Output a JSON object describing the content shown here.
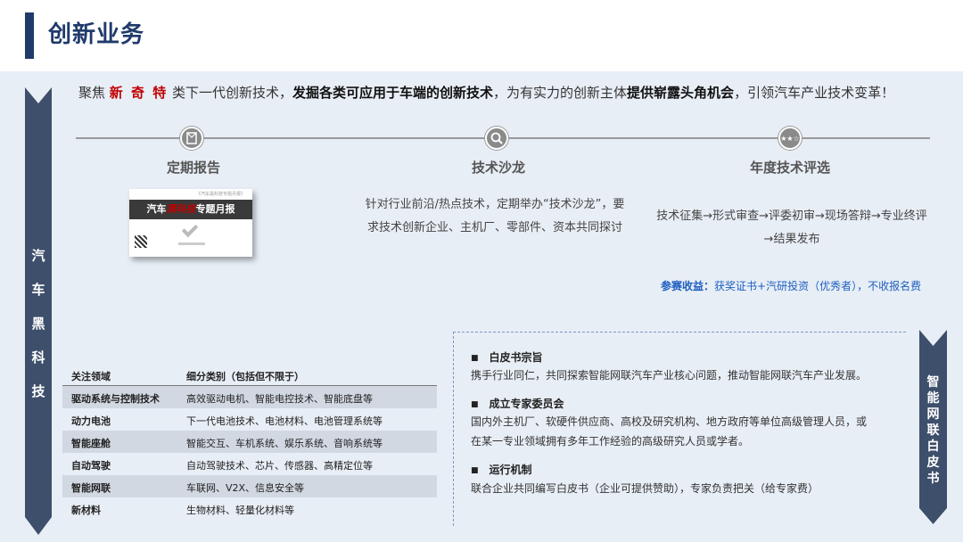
{
  "header": {
    "title": "创新业务"
  },
  "ribbons": {
    "left_label": "汽车黑科技",
    "right_label": "智能网联白皮书"
  },
  "intro": {
    "part1": "聚焦 ",
    "red": "新 奇 特",
    "part2": " 类下一代创新技术，",
    "bold1": "发掘各类可应用于车端的创新技术",
    "part3": "，为有实力的创新主体",
    "bold2": "提供崭露头角机会",
    "part4": "，引领汽车产业技术变革！"
  },
  "columns": [
    {
      "title": "定期报告",
      "icon": "report-icon"
    },
    {
      "title": "技术沙龙",
      "icon": "search-icon",
      "desc": "针对行业前沿/热点技术，定期举办“技术沙龙”，要求技术创新企业、主机厂、零部件、资本共同探讨"
    },
    {
      "title": "年度技术评选",
      "icon": "stars-icon",
      "desc": "技术征集→形式审查→评委初审→现场答辩→专业终评→结果发布"
    }
  ],
  "report_cover": {
    "top_text": "《汽车黑科技专题月报》",
    "band_prefix": "汽车",
    "band_red": "黑科技",
    "band_suffix": "专题月报"
  },
  "benefit": {
    "label": "参赛收益：",
    "text": "获奖证书+汽研投资（优秀者），不收报名费"
  },
  "table": {
    "headers": [
      "关注领域",
      "细分类别（包括但不限于）"
    ],
    "rows": [
      [
        "驱动系统与控制技术",
        "高效驱动电机、智能电控技术、智能底盘等"
      ],
      [
        "动力电池",
        "下一代电池技术、电池材料、电池管理系统等"
      ],
      [
        "智能座舱",
        "智能交互、车机系统、娱乐系统、音响系统等"
      ],
      [
        "自动驾驶",
        "自动驾驶技术、芯片、传感器、高精定位等"
      ],
      [
        "智能网联",
        "车联网、V2X、信息安全等"
      ],
      [
        "新材料",
        "生物材料、轻量化材料等"
      ]
    ]
  },
  "whitepaper": {
    "items": [
      {
        "heading": "白皮书宗旨",
        "lines": [
          "携手行业同仁，共同探索智能网联汽车产业核心问题，推动智能网联汽车产业发展。"
        ]
      },
      {
        "heading": "成立专家委员会",
        "lines": [
          "国内外主机厂、软硬件供应商、高校及研究机构、地方政府等单位高级管理人员，或",
          "在某一专业领域拥有多年工作经验的高级研究人员或学者。"
        ]
      },
      {
        "heading": "运行机制",
        "lines": [
          "联合企业共同编写白皮书（企业可提供赞助），专家负责把关（给专家费）"
        ]
      }
    ]
  },
  "colors": {
    "navy": "#1f3a6b",
    "ribbon": "#3e4f6b",
    "accent_red": "#c00000",
    "benefit_blue": "#1f5fbf",
    "panel_bg": "#e8eef6"
  }
}
